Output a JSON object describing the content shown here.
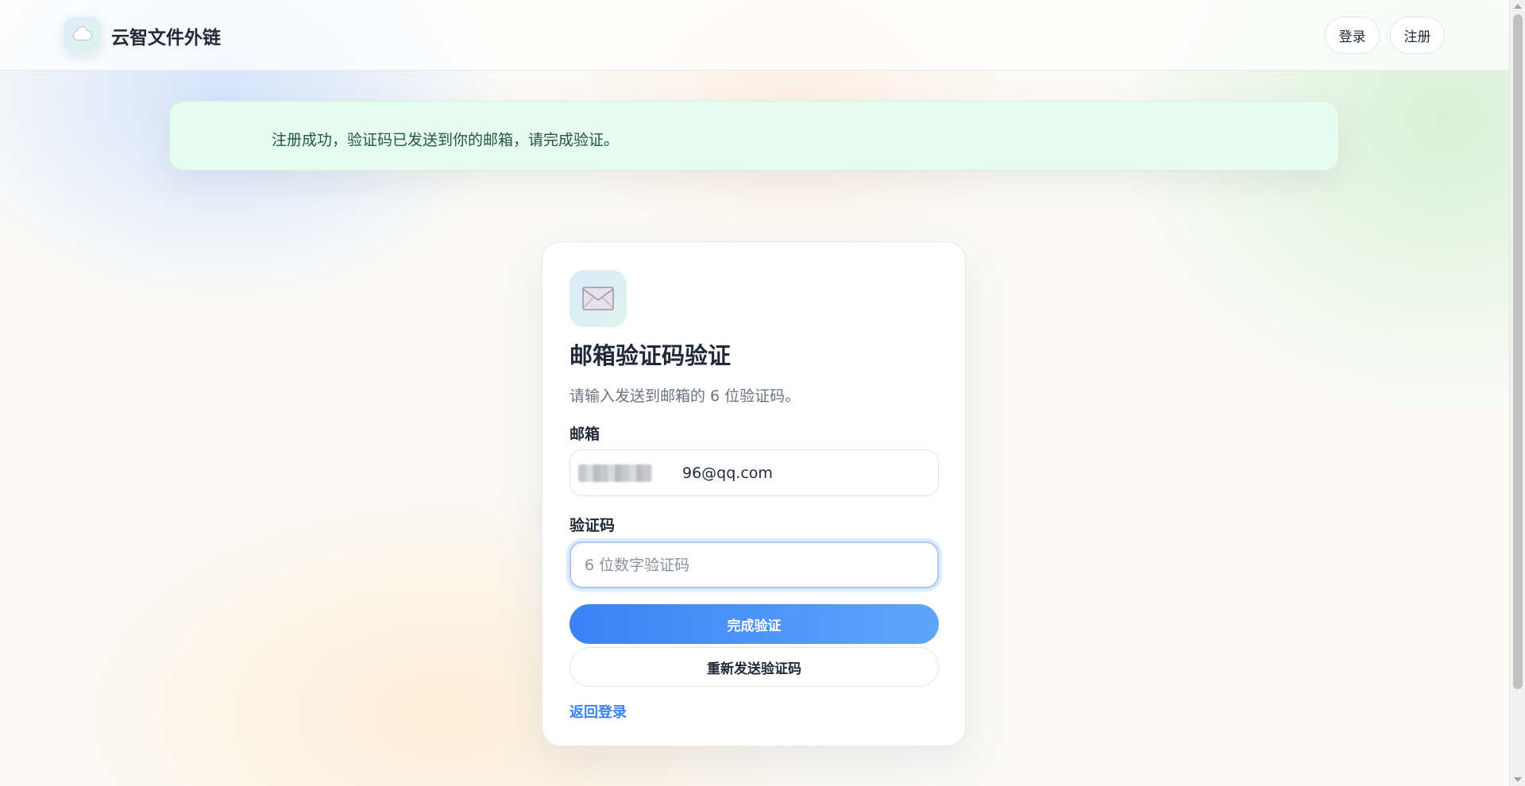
{
  "header": {
    "brand_name": "云智文件外链",
    "login_label": "登录",
    "register_label": "注册"
  },
  "alert": {
    "message": "注册成功，验证码已发送到你的邮箱，请完成验证。"
  },
  "verify": {
    "title": "邮箱验证码验证",
    "subtitle": "请输入发送到邮箱的 6 位验证码。",
    "email_label": "邮箱",
    "email_value": "96@qq.com",
    "code_label": "验证码",
    "code_placeholder": "6 位数字验证码",
    "submit_label": "完成验证",
    "resend_label": "重新发送验证码",
    "back_label": "返回登录"
  },
  "colors": {
    "accent": "#3b82f6",
    "alert_bg": "#e8fbf1",
    "alert_text": "#1f5a3c"
  },
  "icons": {
    "logo": "cloud-icon",
    "card": "envelope-icon"
  }
}
